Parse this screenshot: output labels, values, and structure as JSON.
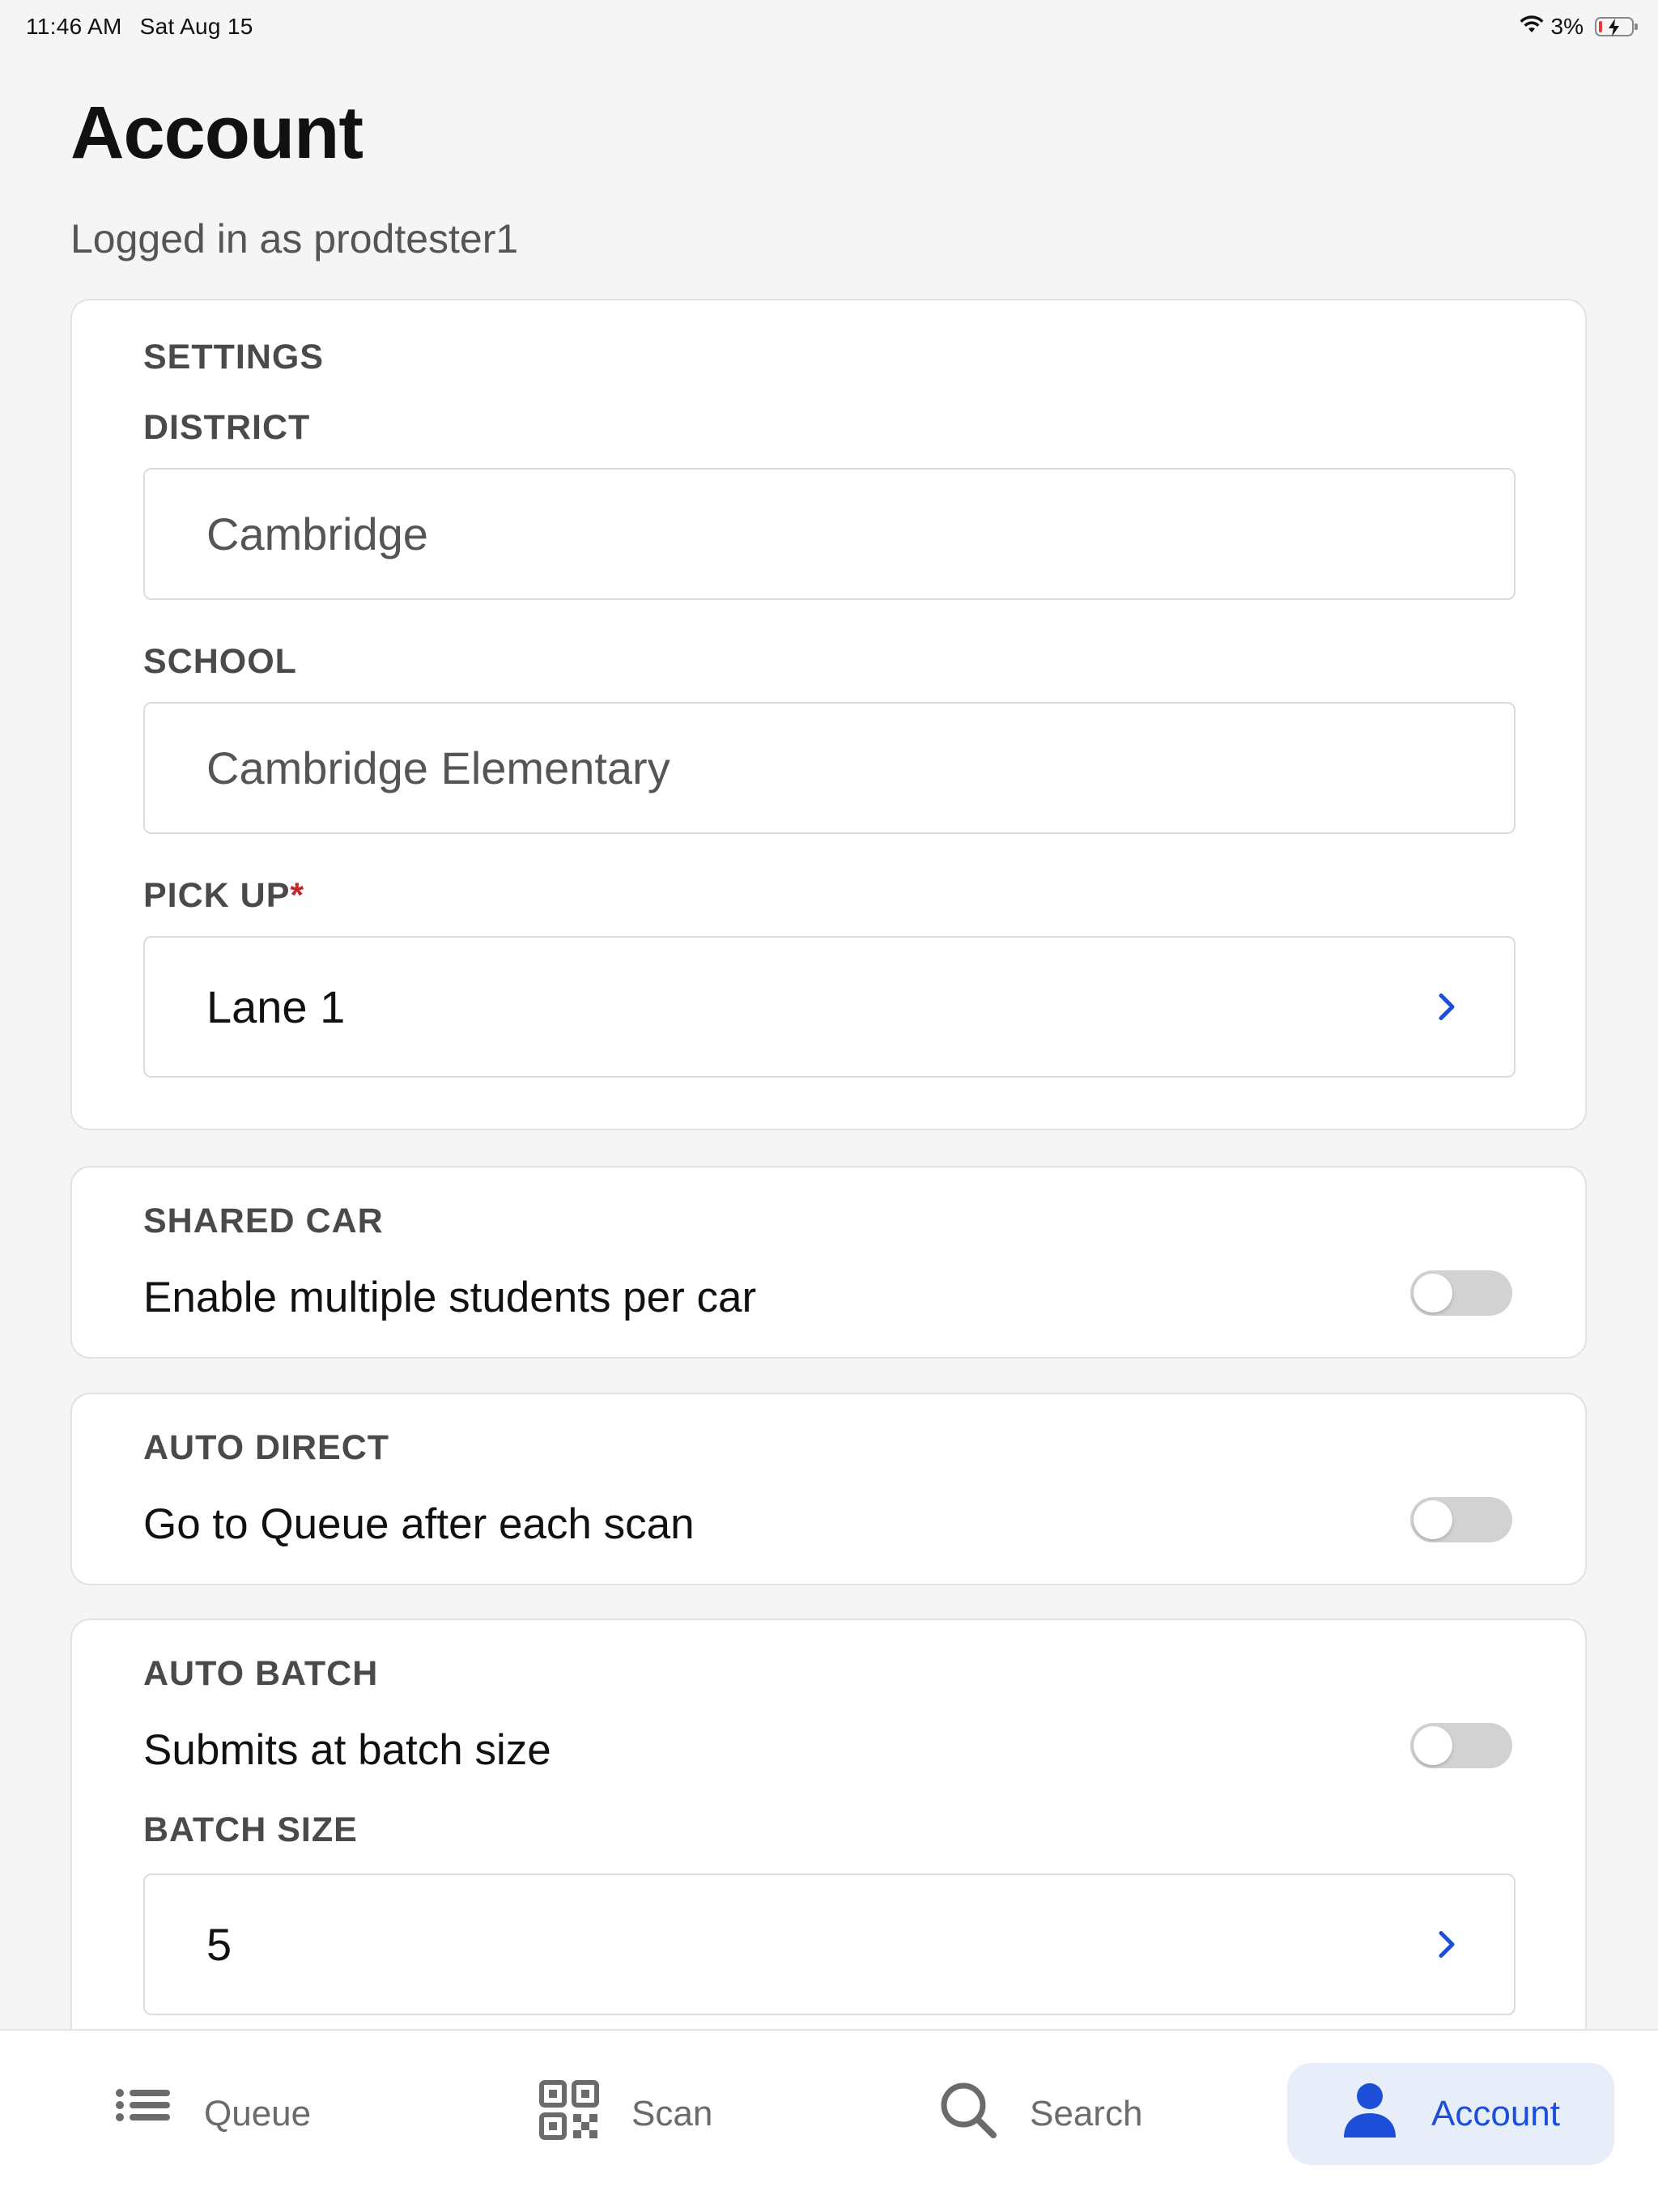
{
  "status_bar": {
    "time": "11:46 AM",
    "date": "Sat Aug 15",
    "battery_percent": "3%"
  },
  "header": {
    "title": "Account",
    "subtitle": "Logged in as prodtester1"
  },
  "settings": {
    "section_label": "SETTINGS",
    "district_label": "DISTRICT",
    "district_value": "Cambridge",
    "school_label": "SCHOOL",
    "school_value": "Cambridge Elementary",
    "pickup_label": "PICK UP",
    "pickup_required_mark": "*",
    "pickup_value": "Lane 1"
  },
  "shared_car": {
    "label": "SHARED CAR",
    "description": "Enable multiple students per car",
    "enabled": false
  },
  "auto_direct": {
    "label": "AUTO DIRECT",
    "description": "Go to Queue after each scan",
    "enabled": false
  },
  "auto_batch": {
    "label": "AUTO BATCH",
    "description": "Submits at batch size",
    "enabled": false,
    "batch_size_label": "BATCH SIZE",
    "batch_size_value": "5"
  },
  "tabs": [
    {
      "label": "Queue",
      "icon": "list-icon",
      "active": false
    },
    {
      "label": "Scan",
      "icon": "qr-code-icon",
      "active": false
    },
    {
      "label": "Search",
      "icon": "search-icon",
      "active": false
    },
    {
      "label": "Account",
      "icon": "person-icon",
      "active": true
    }
  ],
  "colors": {
    "accent": "#1d4ed8",
    "active_tab_bg": "#e7edf9",
    "required": "#c62828",
    "toggle_off": "#d2d2d2"
  }
}
